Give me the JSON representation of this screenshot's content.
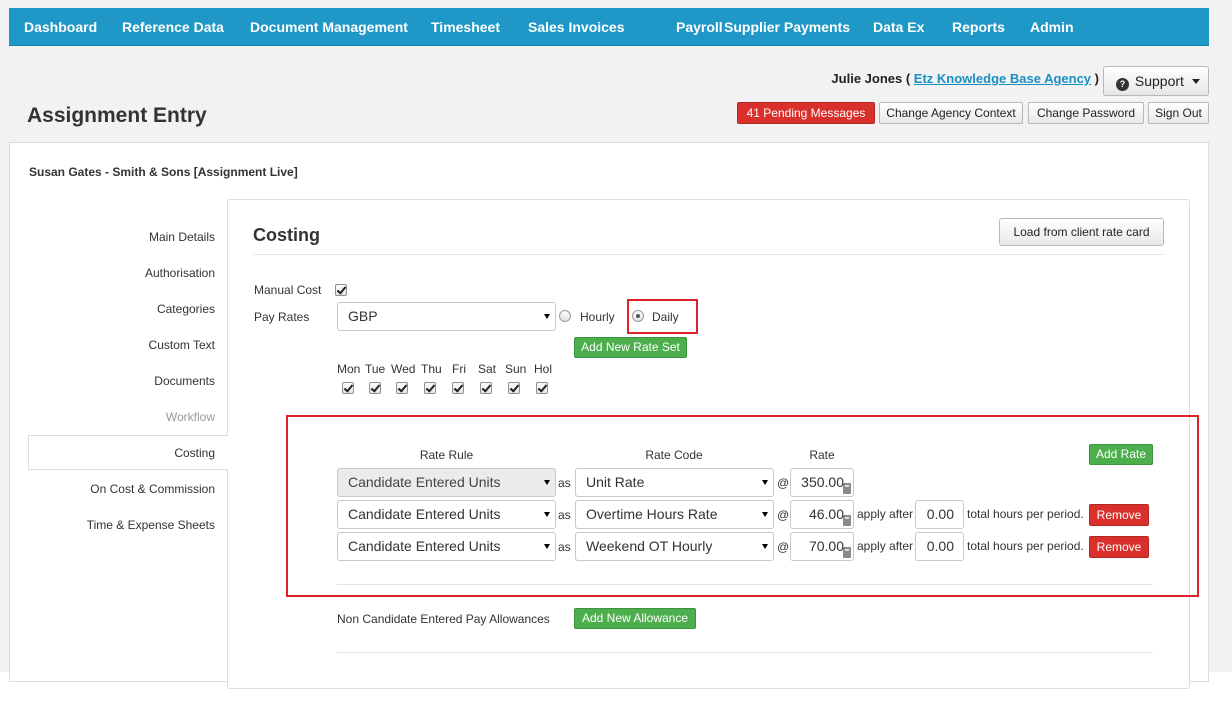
{
  "nav": {
    "items": [
      "Dashboard",
      "Reference Data",
      "Document Management",
      "Timesheet",
      "Sales Invoices",
      "Payroll",
      "Supplier Payments",
      "Data Ex",
      "Reports",
      "Admin"
    ]
  },
  "header": {
    "user_name": "Julie Jones (",
    "agency": "Etz Knowledge Base Agency",
    "agency_close": ")",
    "support_label": "Support",
    "page_title": "Assignment Entry",
    "pending_messages": "41 Pending Messages",
    "change_agency": "Change Agency Context",
    "change_password": "Change Password",
    "sign_out": "Sign Out"
  },
  "assignment": {
    "title": "Susan Gates - Smith & Sons [Assignment Live]"
  },
  "sidebar": {
    "items": [
      {
        "label": "Main Details"
      },
      {
        "label": "Authorisation"
      },
      {
        "label": "Categories"
      },
      {
        "label": "Custom Text"
      },
      {
        "label": "Documents"
      },
      {
        "label": "Workflow"
      },
      {
        "label": "Costing"
      },
      {
        "label": "On Cost & Commission"
      },
      {
        "label": "Time & Expense Sheets"
      }
    ],
    "active": "Costing",
    "muted": "Workflow"
  },
  "costing": {
    "title": "Costing",
    "load_button": "Load from client rate card",
    "manual_cost_label": "Manual Cost",
    "manual_cost_checked": true,
    "pay_rates_label": "Pay Rates",
    "currency": "GBP",
    "hourly_label": "Hourly",
    "daily_label": "Daily",
    "selected_rate_type": "Daily",
    "add_rate_set": "Add New Rate Set",
    "days": [
      "Mon",
      "Tue",
      "Wed",
      "Thu",
      "Fri",
      "Sat",
      "Sun",
      "Hol"
    ],
    "columns": {
      "rate_rule": "Rate Rule",
      "rate_code": "Rate Code",
      "rate": "Rate"
    },
    "add_rate": "Add Rate",
    "as_label": "as",
    "at_label": "@",
    "apply_after_label": "apply after",
    "total_hours_label": "total hours per period.",
    "remove_label": "Remove",
    "rows": [
      {
        "rule": "Candidate Entered Units",
        "code": "Unit Rate",
        "rate": "350.00"
      },
      {
        "rule": "Candidate Entered Units",
        "code": "Overtime Hours Rate",
        "rate": "46.00",
        "apply_after": "0.00"
      },
      {
        "rule": "Candidate Entered Units",
        "code": "Weekend OT Hourly",
        "rate": "70.00",
        "apply_after": "0.00"
      }
    ],
    "allowances_label": "Non Candidate Entered Pay Allowances",
    "add_allowance": "Add New Allowance"
  },
  "colors": {
    "nav_bg": "#1f98c7",
    "accent_green": "#4cae4c",
    "danger_red": "#d9302c",
    "highlight": "#e0232b"
  }
}
